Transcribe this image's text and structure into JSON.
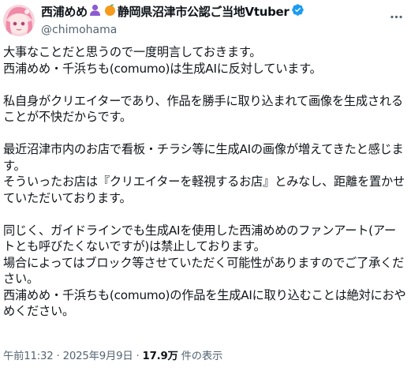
{
  "post": {
    "display_name": "西浦めめ",
    "badge_1": "purple-person-emoji",
    "badge_2": "orange-fruit-emoji",
    "affiliation": "静岡県沼津市公認ご当地Vtuber",
    "verified_icon": "verified-badge-icon",
    "handle": "@chimohama",
    "more_icon": "more-options-icon",
    "paragraphs": [
      "大事なことだと思うので一度明言しておきます。\n西浦めめ・千浜ちも(comumo)は生成AIに反対しています。",
      "私自身がクリエイターであり、作品を勝手に取り込まれて画像を生成されることが不快だからです。",
      "最近沼津市内のお店で看板・チラシ等に生成AIの画像が増えてきたと感じます。\nそういったお店は『クリエイターを軽視するお店』とみなし、距離を置かせていただいております。",
      "同じく、ガイドラインでも生成AIを使用した西浦めめのファンアート(アートとも呼びたくないですが)は禁止しております。\n場合によってはブロック等させていただく可能性がありますのでご了承ください。\n西浦めめ・千浜ちも(comumo)の作品を生成AIに取り込むことは絶対におやめください。"
    ],
    "timestamp": "午前11:32 · 2025年9月9日 · ",
    "views_count": "17.9万",
    "views_label": " 件の表示"
  },
  "colors": {
    "text": "#0f1419",
    "secondary": "#536471",
    "verified": "#1d9bf0"
  }
}
